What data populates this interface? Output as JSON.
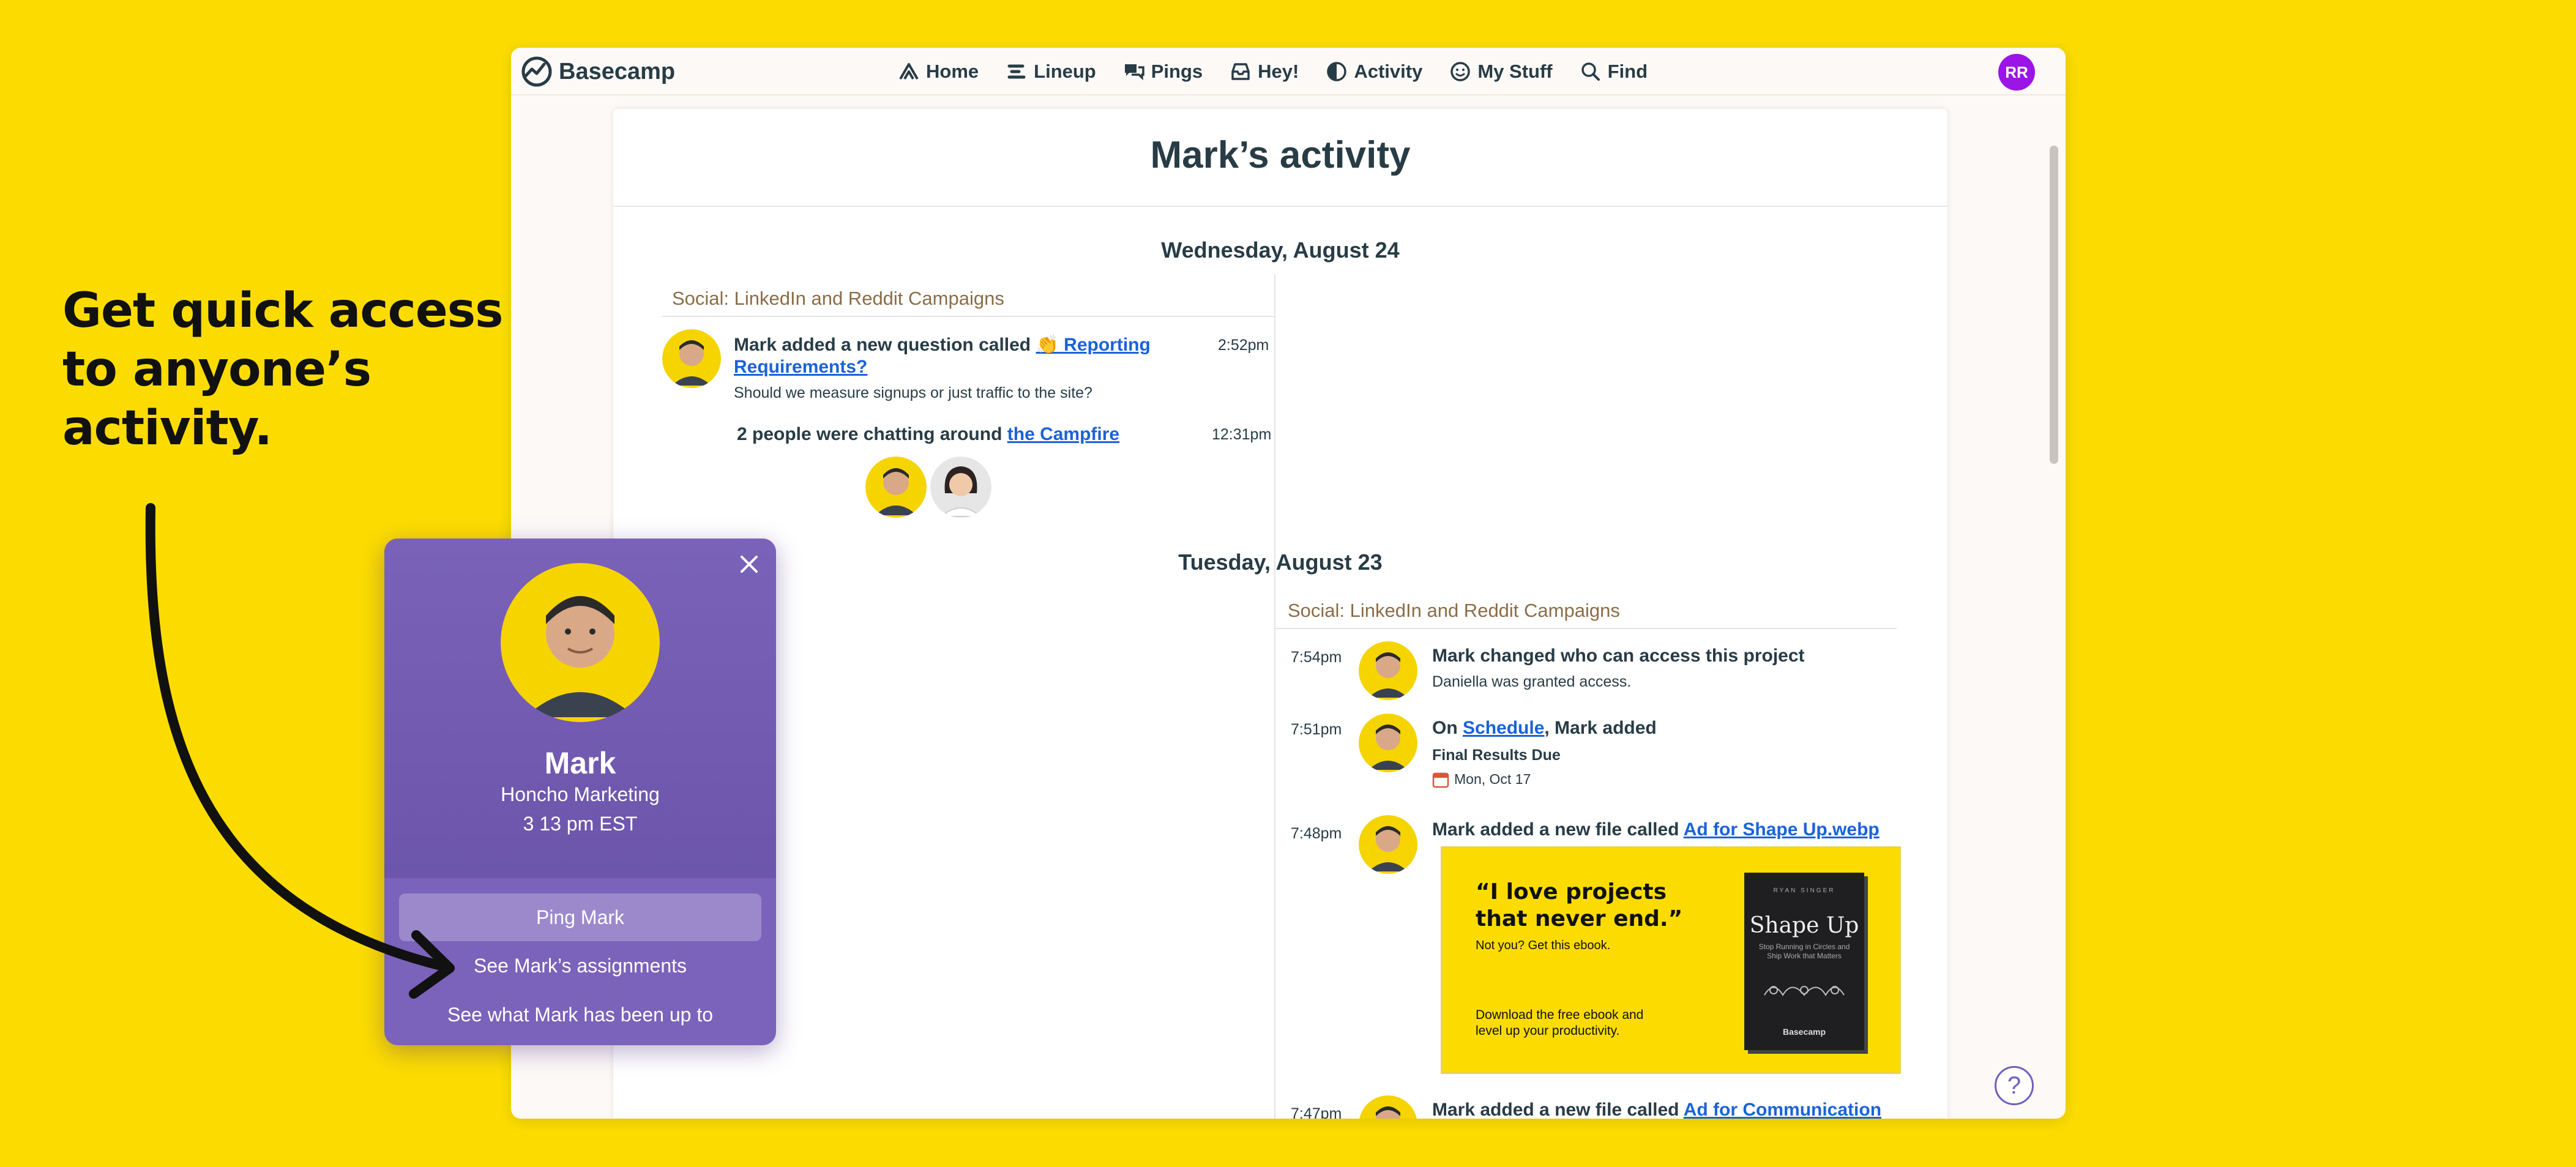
{
  "headline": [
    "Get quick access",
    "to anyone’s",
    "activity."
  ],
  "colors": {
    "background": "#fcdc00",
    "popup": "#7b62ba",
    "link": "#1b62d9",
    "avatar_rr": "#9b15e6"
  },
  "app": {
    "logo_text": "Basecamp",
    "avatar_initials": "RR"
  },
  "nav": [
    {
      "label": "Home",
      "icon": "home-icon"
    },
    {
      "label": "Lineup",
      "icon": "lineup-icon"
    },
    {
      "label": "Pings",
      "icon": "pings-icon"
    },
    {
      "label": "Hey!",
      "icon": "hey-inbox-icon"
    },
    {
      "label": "Activity",
      "icon": "activity-icon"
    },
    {
      "label": "My Stuff",
      "icon": "smiley-icon"
    },
    {
      "label": "Find",
      "icon": "search-icon"
    }
  ],
  "page": {
    "title": "Mark’s activity"
  },
  "days": [
    {
      "date": "Wednesday, August 24",
      "bucket": "Social: LinkedIn and Reddit Campaigns",
      "events": [
        {
          "prefix": "Mark added a new question called ",
          "link": "👏 Reporting Requirements?",
          "sub": "Should we measure signups or just traffic to the site?",
          "time": "2:52pm"
        },
        {
          "prefix": "2 people were chatting around ",
          "link": "the Campfire",
          "time": "12:31pm"
        }
      ]
    },
    {
      "date": "Tuesday, August 23",
      "bucket": "Social: LinkedIn and Reddit Campaigns",
      "events": [
        {
          "title": "Mark changed who can access this project",
          "sub": "Daniella was granted access.",
          "time": "7:54pm"
        },
        {
          "prefix": "On ",
          "link": "Schedule",
          "suffix": ", Mark added",
          "sub": "Final Results Due",
          "date_note": "Mon, Oct 17",
          "time": "7:51pm"
        },
        {
          "prefix": "Mark added a new file called ",
          "link": "Ad for Shape Up.webp",
          "time": "7:48pm"
        },
        {
          "prefix": "Mark added a new file called ",
          "link": "Ad for Communication",
          "time": "7:47pm"
        }
      ]
    }
  ],
  "ad": {
    "quote": [
      "“I love projects",
      "that never end.”"
    ],
    "sub": "Not you? Get this ebook.",
    "footer": [
      "Download the free ebook and",
      "level up your productivity."
    ],
    "book_author": "RYAN SINGER",
    "book_title": "Shape Up",
    "book_tagline": "Stop Running in Circles and Ship Work that Matters",
    "book_brand": "Basecamp"
  },
  "popup": {
    "name": "Mark",
    "role": "Honcho Marketing",
    "time": "3 13 pm EST",
    "ping_label": "Ping Mark",
    "assignments_label": "See Mark’s assignments",
    "activity_label": "See what Mark has been up to"
  },
  "help": {
    "label": "?"
  }
}
